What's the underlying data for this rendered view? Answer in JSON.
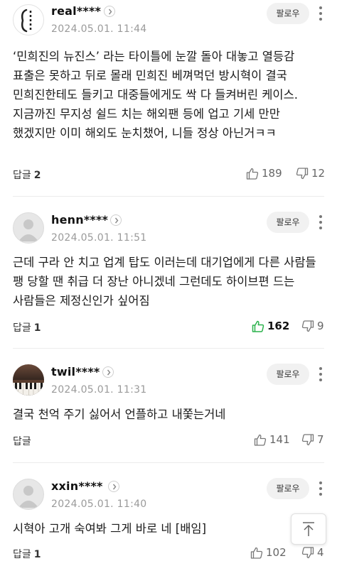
{
  "comments": [
    {
      "username": "real****",
      "date": "2024.05.01. 11:44",
      "follow_label": "팔로우",
      "avatar": "custom-avatar",
      "text": "‘민희진의 뉴진스’ 라는 타이틀에 눈깔 돌아 대놓고 열등감 표출은 못하고 뒤로 몰래 민희진 베껴먹던 방시혁이 결국 민희진한테도 들키고 대중들에게도 싹 다 들켜버린 케이스.지금까진 무지성 쉴드 치는 해외팬 등에 업고 기세 만만 했겠지만 이미 해외도 눈치챘어, 니들 정상 아닌거ㅋㅋ",
      "reply_label": "답글",
      "reply_count": "2",
      "likes": "189",
      "dislikes": "12",
      "liked": false
    },
    {
      "username": "henn****",
      "date": "2024.05.01. 11:51",
      "follow_label": "팔로우",
      "avatar": "default-avatar",
      "text": "근데 구라 안 치고 업계 탑도 이러는데 대기업에게 다른 사람들 팽 당할 땐 취급 더 장난 아니겠네 그런데도 하이브편 드는 사람들은 제정신인가 싶어짐",
      "reply_label": "답글",
      "reply_count": "1",
      "likes": "162",
      "dislikes": "9",
      "liked": true
    },
    {
      "username": "twil****",
      "date": "2024.05.01. 11:31",
      "follow_label": "팔로우",
      "avatar": "piano-photo-avatar",
      "text": "결국 천억 주기 싫어서 언플하고 내쫓는거네",
      "reply_label": "답글",
      "reply_count": "",
      "likes": "141",
      "dislikes": "7",
      "liked": false
    },
    {
      "username": "xxin****",
      "date": "2024.05.01. 11:40",
      "follow_label": "팔로우",
      "avatar": "default-avatar",
      "text": "시혁아 고개 숙여봐 그게 바로 네 [배임]",
      "reply_label": "답글",
      "reply_count": "1",
      "likes": "102",
      "dislikes": "4",
      "liked": false
    }
  ],
  "colors": {
    "like_active": "#2bb24c",
    "muted": "#9a9a9a",
    "follow_bg": "#f1f1f1"
  },
  "icons": [
    "chevron-right-icon",
    "more-vertical-icon",
    "thumbs-up-icon",
    "thumbs-down-icon",
    "arrow-up-icon"
  ]
}
